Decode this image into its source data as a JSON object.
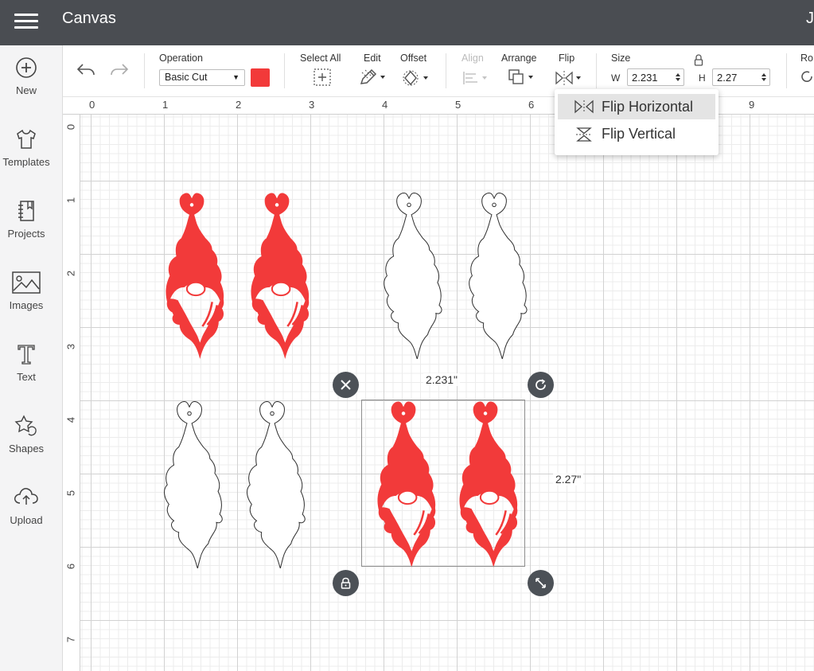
{
  "header": {
    "title": "Canvas",
    "user_initial": "J"
  },
  "sidebar": {
    "items": [
      {
        "label": "New",
        "icon": "plus-circle-icon"
      },
      {
        "label": "Templates",
        "icon": "tshirt-icon"
      },
      {
        "label": "Projects",
        "icon": "notebook-icon"
      },
      {
        "label": "Images",
        "icon": "image-icon"
      },
      {
        "label": "Text",
        "icon": "text-t-icon"
      },
      {
        "label": "Shapes",
        "icon": "shapes-icon"
      },
      {
        "label": "Upload",
        "icon": "cloud-upload-icon"
      }
    ]
  },
  "toolbar": {
    "operation_label": "Operation",
    "operation_value": "Basic Cut",
    "operation_color": "#f23a3a",
    "select_all_label": "Select All",
    "edit_label": "Edit",
    "offset_label": "Offset",
    "align_label": "Align",
    "arrange_label": "Arrange",
    "flip_label": "Flip",
    "size_label": "Size",
    "width_prefix": "W",
    "width_value": "2.231",
    "height_prefix": "H",
    "height_value": "2.27",
    "rotate_label": "Ro"
  },
  "ruler": {
    "top": [
      "0",
      "1",
      "2",
      "3",
      "4",
      "5",
      "6",
      "9"
    ],
    "left": [
      "0",
      "1",
      "2",
      "3",
      "4",
      "5",
      "6",
      "7"
    ]
  },
  "flip_menu": {
    "items": [
      {
        "label": "Flip Horizontal",
        "icon": "flip-horizontal-icon",
        "highlighted": true
      },
      {
        "label": "Flip Vertical",
        "icon": "flip-vertical-icon",
        "highlighted": false
      }
    ]
  },
  "selection": {
    "width_label": "2.231\"",
    "height_label": "2.27\""
  },
  "colors": {
    "header_bg": "#4a4d52",
    "shape_red": "#f23a3a",
    "handle_bg": "#4c5157"
  }
}
